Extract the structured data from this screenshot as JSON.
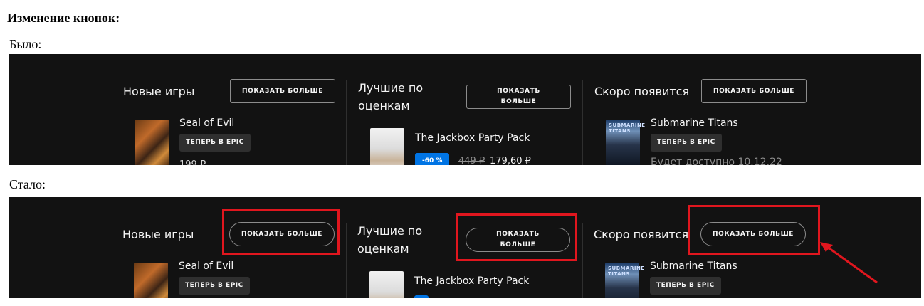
{
  "doc": {
    "heading": "Изменение кнопок:",
    "before_label": "Было:",
    "after_label": "Стало:"
  },
  "columns": [
    {
      "title": "Новые игры",
      "button": "ПОКАЗАТЬ БОЛЬШЕ",
      "game": "Seal of Evil",
      "tag": "ТЕПЕРЬ В EPIC",
      "price": "199 ₽"
    },
    {
      "title_line1": "Лучшие по",
      "title_line2": "оценкам",
      "button_line1": "ПОКАЗАТЬ",
      "button_line2": "БОЛЬШЕ",
      "game": "The Jackbox Party Pack",
      "discount": "-60 %",
      "old_price": "449 ₽",
      "new_price": "179,60 ₽"
    },
    {
      "title": "Скоро появится",
      "button": "ПОКАЗАТЬ БОЛЬШЕ",
      "game": "Submarine Titans",
      "cover_logo": "SUBMARINE TITANS",
      "tag": "ТЕПЕРЬ В EPIC",
      "status": "Будет доступно 10.12.22"
    }
  ],
  "icons": {
    "annotation_arrow": "arrow-icon"
  },
  "colors": {
    "panel_bg": "#121212",
    "highlight": "#e0161e",
    "discount_badge": "#0074e4"
  }
}
